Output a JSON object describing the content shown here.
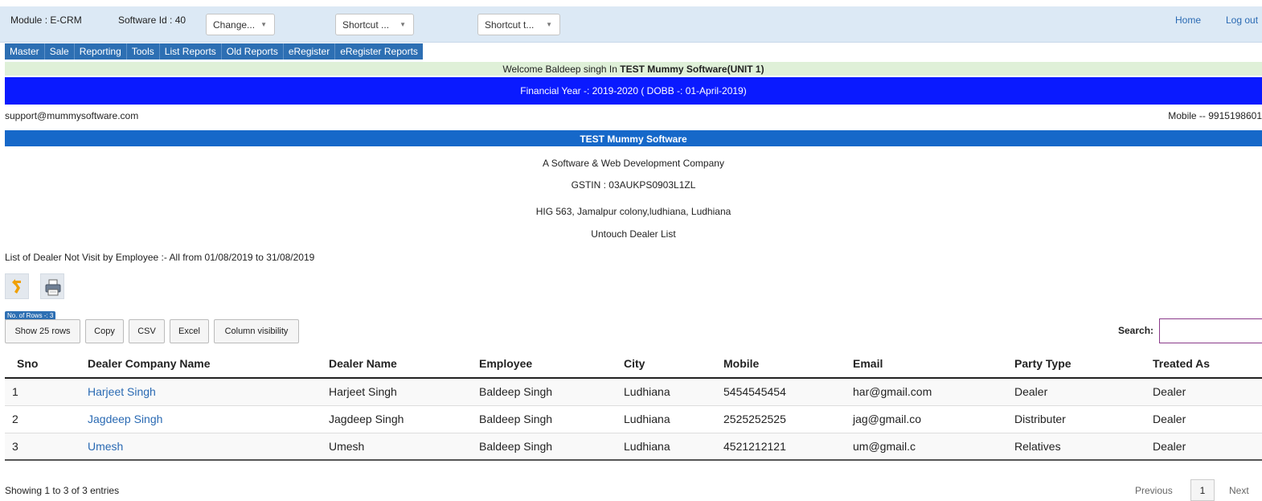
{
  "header": {
    "module": "Module : E-CRM",
    "software_id": "Software Id : 40",
    "change_dropdown": "Change...",
    "shortcut1": "Shortcut ...",
    "shortcut2": "Shortcut t...",
    "home": "Home",
    "logout": "Log out"
  },
  "menu": [
    "Master",
    "Sale",
    "Reporting",
    "Tools",
    "List Reports",
    "Old Reports",
    "eRegister",
    "eRegister Reports"
  ],
  "welcome": {
    "prefix": "Welcome Baldeep singh In ",
    "strong": "TEST Mummy Software(UNIT 1)"
  },
  "financial_year": "Financial Year -: 2019-2020 ( DOBB -: 01-April-2019)",
  "contact": {
    "email": "support@mummysoftware.com",
    "mobile": "Mobile -- 9915198601"
  },
  "company": {
    "name": "TEST Mummy Software",
    "tagline": "A Software & Web Development Company",
    "gstin": "GSTIN : 03AUKPS0903L1ZL",
    "address": "HIG 563, Jamalpur colony,ludhiana, Ludhiana",
    "report_title": "Untouch Dealer List"
  },
  "list_caption": "List of Dealer Not Visit by Employee :- All from 01/08/2019 to 31/08/2019",
  "toolbar": {
    "rows_badge": "No. of Rows -: 3",
    "show_rows": "Show 25 rows",
    "copy": "Copy",
    "csv": "CSV",
    "excel": "Excel",
    "column_visibility": "Column visibility",
    "search_label": "Search:",
    "search_value": ""
  },
  "icons": {
    "back": "back-arrow-icon",
    "print": "printer-icon",
    "accent": "#f0a000"
  },
  "table": {
    "columns": [
      "Sno",
      "Dealer Company Name",
      "Dealer Name",
      "Employee",
      "City",
      "Mobile",
      "Email",
      "Party Type",
      "Treated As"
    ],
    "rows": [
      [
        "1",
        "Harjeet Singh",
        "Harjeet Singh",
        "Baldeep Singh",
        "Ludhiana",
        "5454545454",
        "har@gmail.com",
        "Dealer",
        "Dealer"
      ],
      [
        "2",
        "Jagdeep Singh",
        "Jagdeep Singh",
        "Baldeep Singh",
        "Ludhiana",
        "2525252525",
        "jag@gmail.co",
        "Distributer",
        "Dealer"
      ],
      [
        "3",
        "Umesh",
        "Umesh",
        "Baldeep Singh",
        "Ludhiana",
        "4521212121",
        "um@gmail.c",
        "Relatives",
        "Dealer"
      ]
    ]
  },
  "footer": {
    "showing": "Showing 1 to 3 of 3 entries",
    "previous": "Previous",
    "page": "1",
    "next": "Next"
  }
}
